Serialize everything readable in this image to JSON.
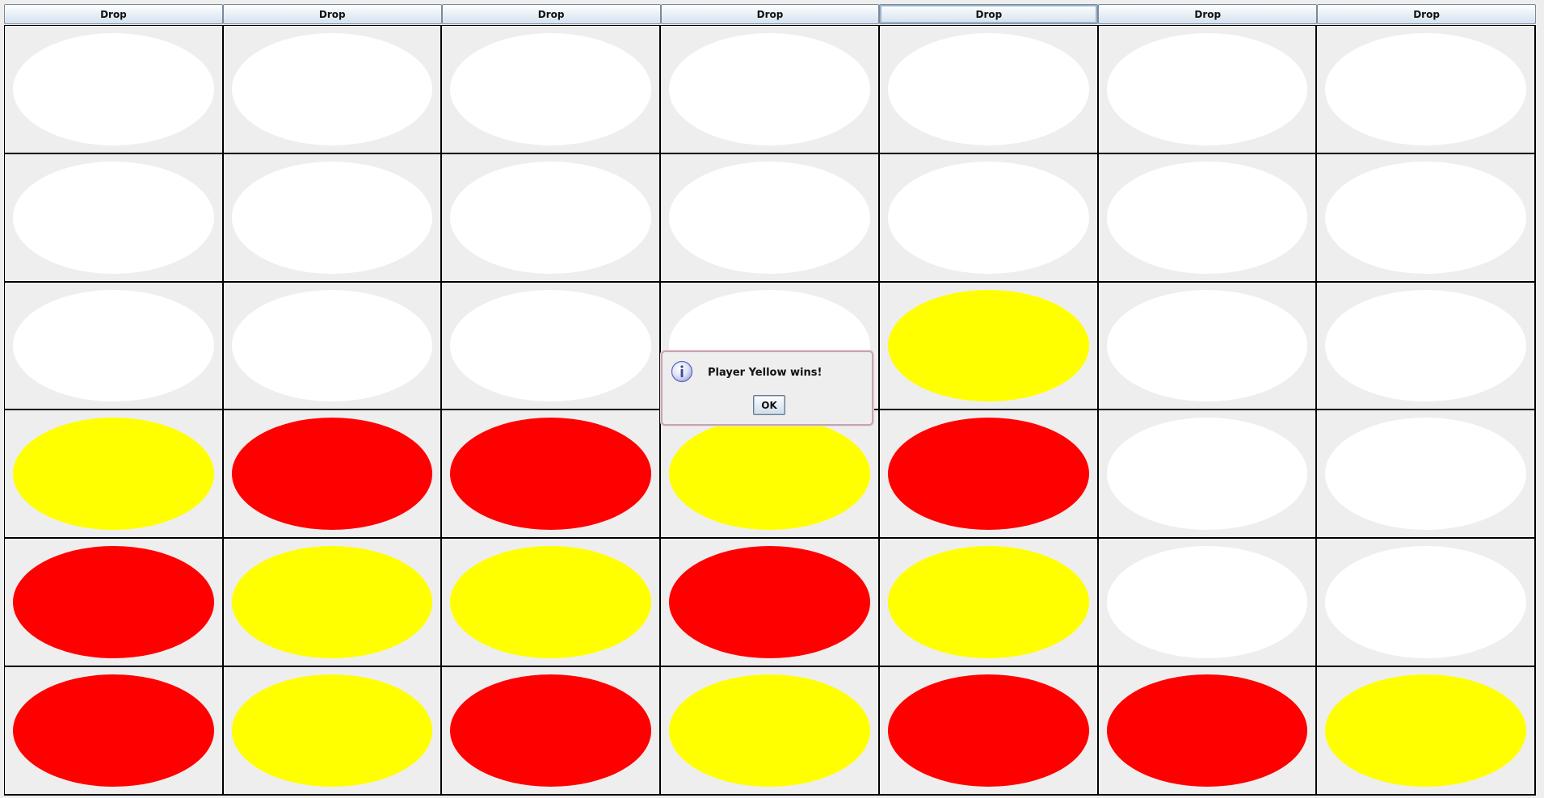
{
  "drop_buttons": [
    {
      "label": "Drop"
    },
    {
      "label": "Drop"
    },
    {
      "label": "Drop"
    },
    {
      "label": "Drop"
    },
    {
      "label": "Drop"
    },
    {
      "label": "Drop"
    },
    {
      "label": "Drop"
    }
  ],
  "focused_column": 4,
  "colors": {
    "empty": "#ffffff",
    "red": "#ff0000",
    "yellow": "#ffff00"
  },
  "board": [
    [
      "empty",
      "empty",
      "empty",
      "empty",
      "empty",
      "empty",
      "empty"
    ],
    [
      "empty",
      "empty",
      "empty",
      "empty",
      "empty",
      "empty",
      "empty"
    ],
    [
      "empty",
      "empty",
      "empty",
      "empty",
      "yellow",
      "empty",
      "empty"
    ],
    [
      "yellow",
      "red",
      "red",
      "yellow",
      "red",
      "empty",
      "empty"
    ],
    [
      "red",
      "yellow",
      "yellow",
      "red",
      "yellow",
      "empty",
      "empty"
    ],
    [
      "red",
      "yellow",
      "red",
      "yellow",
      "red",
      "red",
      "yellow"
    ]
  ],
  "dialog": {
    "icon": "info-icon",
    "message": "Player Yellow wins!",
    "ok_label": "OK"
  }
}
